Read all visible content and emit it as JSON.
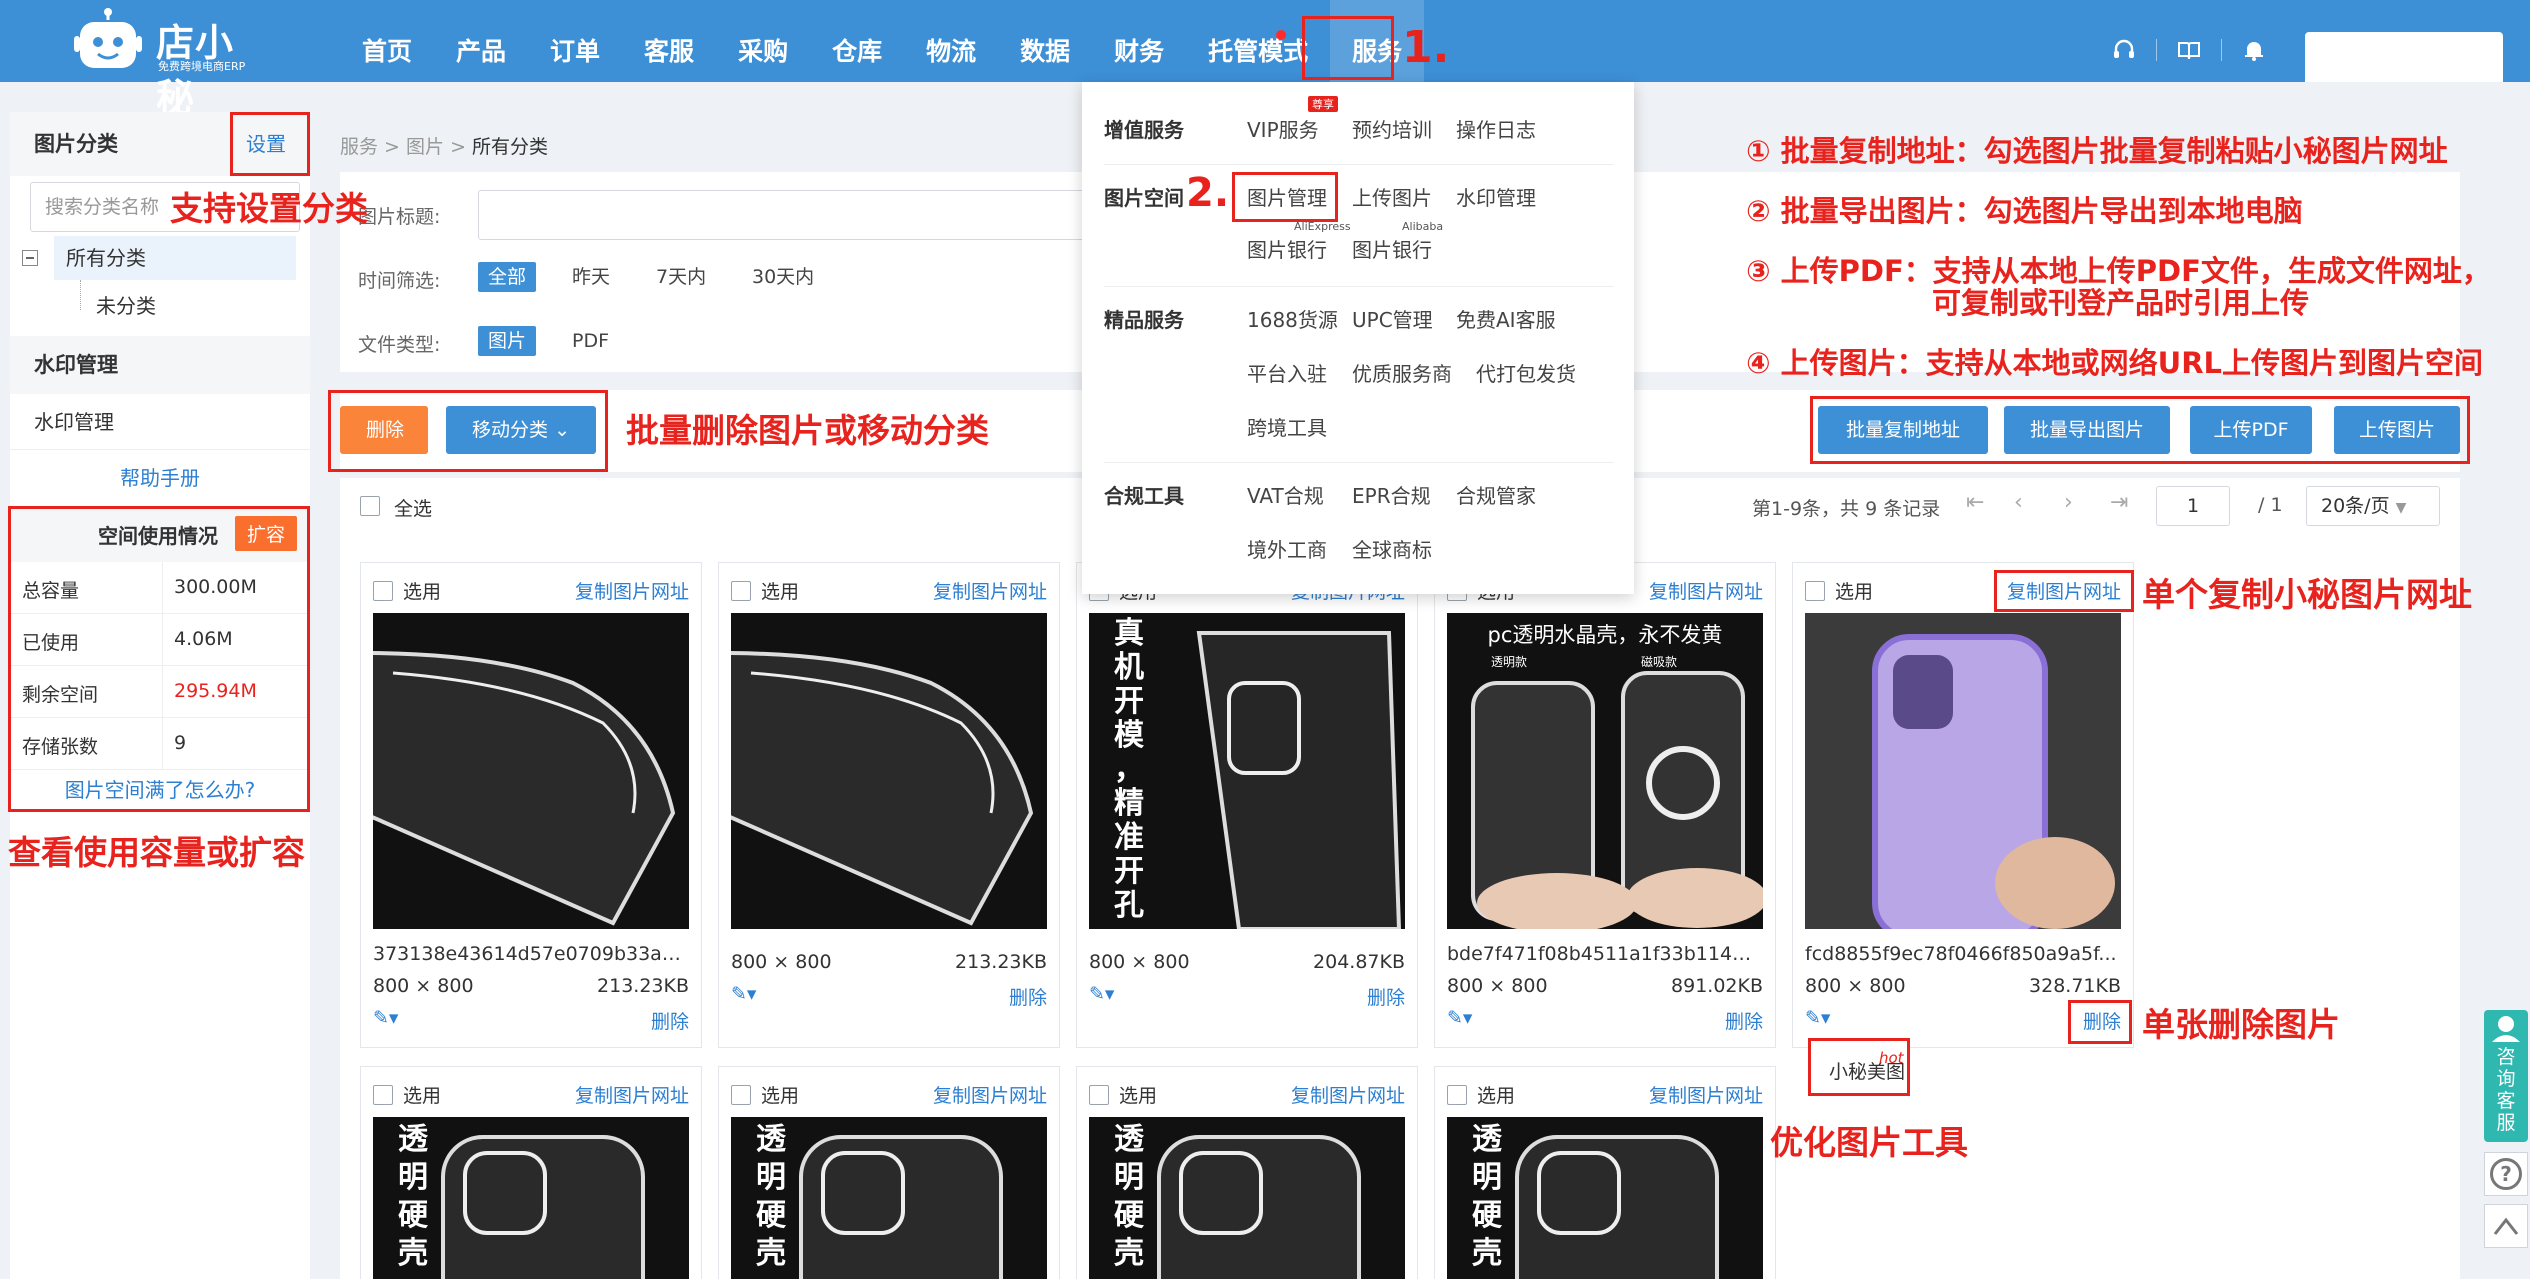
{
  "brand": {
    "name": "店小秘",
    "tagline": "免费跨境电商ERP"
  },
  "nav": [
    "首页",
    "产品",
    "订单",
    "客服",
    "采购",
    "仓库",
    "物流",
    "数据",
    "财务",
    "托管模式",
    "服务"
  ],
  "nav_active": "服务",
  "sidebar": {
    "category_title": "图片分类",
    "settings_label": "设置",
    "search_placeholder": "搜索分类名称",
    "tree": {
      "root": "所有分类",
      "child": "未分类"
    },
    "watermark_section": "水印管理",
    "watermark_item": "水印管理",
    "help_link": "帮助手册",
    "usage_title": "空间使用情况",
    "expand_label": "扩容",
    "usage": [
      {
        "label": "总容量",
        "value": "300.00M"
      },
      {
        "label": "已使用",
        "value": "4.06M"
      },
      {
        "label": "剩余空间",
        "value": "295.94M"
      },
      {
        "label": "存储张数",
        "value": "9"
      }
    ],
    "full_link": "图片空间满了怎么办?"
  },
  "breadcrumb": {
    "a": "服务",
    "b": "图片",
    "c": "所有分类"
  },
  "filters": {
    "title_label": "图片标题:",
    "time_label": "时间筛选:",
    "time_options": [
      "全部",
      "昨天",
      "7天内",
      "30天内"
    ],
    "type_label": "文件类型:",
    "type_options": [
      "图片",
      "PDF"
    ]
  },
  "toolbar": {
    "delete": "删除",
    "move": "移动分类",
    "batch_copy": "批量复制地址",
    "batch_export": "批量导出图片",
    "upload_pdf": "上传PDF",
    "upload_img": "上传图片"
  },
  "list": {
    "select_all": "全选",
    "pager_summary": "第1-9条，共 9 条记录",
    "page": "1",
    "total_pages": "/ 1",
    "page_size": "20条/页"
  },
  "card_labels": {
    "select": "选用",
    "copy": "复制图片网址",
    "delete": "删除"
  },
  "cards": [
    {
      "name": "373138e43614d57e0709b33a7...",
      "dim": "800 × 800",
      "size": "213.23KB"
    },
    {
      "name": "",
      "dim": "800 × 800",
      "size": "213.23KB"
    },
    {
      "name": "",
      "dim": "800 × 800",
      "size": "204.87KB"
    },
    {
      "name": "bde7f471f08b4511a1f33b114bf...",
      "dim": "800 × 800",
      "size": "891.02KB"
    },
    {
      "name": "fcd8855f9ec78f0466f850a9a5f...",
      "dim": "800 × 800",
      "size": "328.71KB"
    }
  ],
  "image_texts": {
    "card3": [
      "真",
      "机",
      "开",
      "模",
      "，",
      "精",
      "准",
      "开",
      "孔"
    ],
    "card4_title": "pc透明水晶壳，永不发黄",
    "card4_left": "透明款",
    "card4_right": "磁吸款",
    "row2": [
      "透",
      "明",
      "硬",
      "壳"
    ]
  },
  "dropdown": {
    "groups": [
      {
        "name": "增值服务",
        "links": [
          "VIP服务",
          "预约培训",
          "操作日志"
        ]
      },
      {
        "name": "图片空间",
        "links": [
          "图片管理",
          "上传图片",
          "水印管理",
          "图片银行",
          "图片银行"
        ]
      },
      {
        "name": "精品服务",
        "links": [
          "1688货源",
          "UPC管理",
          "免费AI客服",
          "平台入驻",
          "优质服务商",
          "代打包发货",
          "跨境工具"
        ]
      },
      {
        "name": "合规工具",
        "links": [
          "VAT合规",
          "EPR合规",
          "合规管家",
          "境外工商",
          "全球商标"
        ]
      }
    ],
    "badge": "尊享",
    "tag_aliexpress": "AliExpress",
    "tag_alibaba": "Alibaba"
  },
  "annotations": {
    "step1": "1.",
    "step2": "2.",
    "sidebar_setting": "支持设置分类",
    "usage": "查看使用容量或扩容",
    "batch_ops": "批量删除图片或移动分类",
    "note1": "① 批量复制地址：勾选图片批量复制粘贴小秘图片网址",
    "note2": "② 批量导出图片：勾选图片导出到本地电脑",
    "note3a": "③ 上传PDF：支持从本地上传PDF文件，生成文件网址，",
    "note3b": "可复制或刊登产品时引用上传",
    "note4": "④ 上传图片：支持从本地或网络URL上传图片到图片空间",
    "single_copy": "单个复制小秘图片网址",
    "single_delete": "单张删除图片",
    "optimize": "优化图片工具"
  },
  "tooltip": {
    "label": "小秘美图",
    "hot": "hot"
  },
  "float": {
    "cs": "咨询客服",
    "help": "?"
  },
  "colors": {
    "nav_bg": "#3d8fd6",
    "accent": "#2d7fd1",
    "annotation": "#e8221d",
    "orange": "#f9843a",
    "danger_text": "#e8221d"
  }
}
